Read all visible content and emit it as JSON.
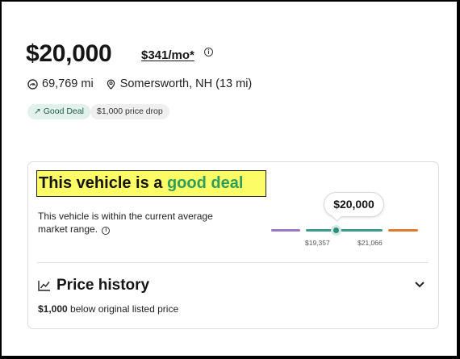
{
  "listing": {
    "price": "$20,000",
    "monthly_payment": "$341/mo*",
    "mileage": "69,769 mi",
    "location": "Somersworth, NH (13 mi)",
    "badges": [
      {
        "icon": "↗",
        "label": "Good Deal"
      },
      {
        "label": "$1,000 price drop"
      }
    ]
  },
  "deal": {
    "title_prefix": "This vehicle is a ",
    "title_highlight": "good deal",
    "description": "This vehicle is within the current average market range.",
    "range": {
      "current_price": "$20,000",
      "low_label": "$19,357",
      "high_label": "$21,066"
    }
  },
  "price_history": {
    "title": "Price history",
    "amount": "$1,000",
    "detail": "below original listed price"
  },
  "colors": {
    "good_green": "#2f9e5b",
    "range_low": "#9d77c6",
    "range_mid": "#3b9b8d",
    "range_high": "#e07b2e",
    "highlight": "#fcfc66"
  }
}
